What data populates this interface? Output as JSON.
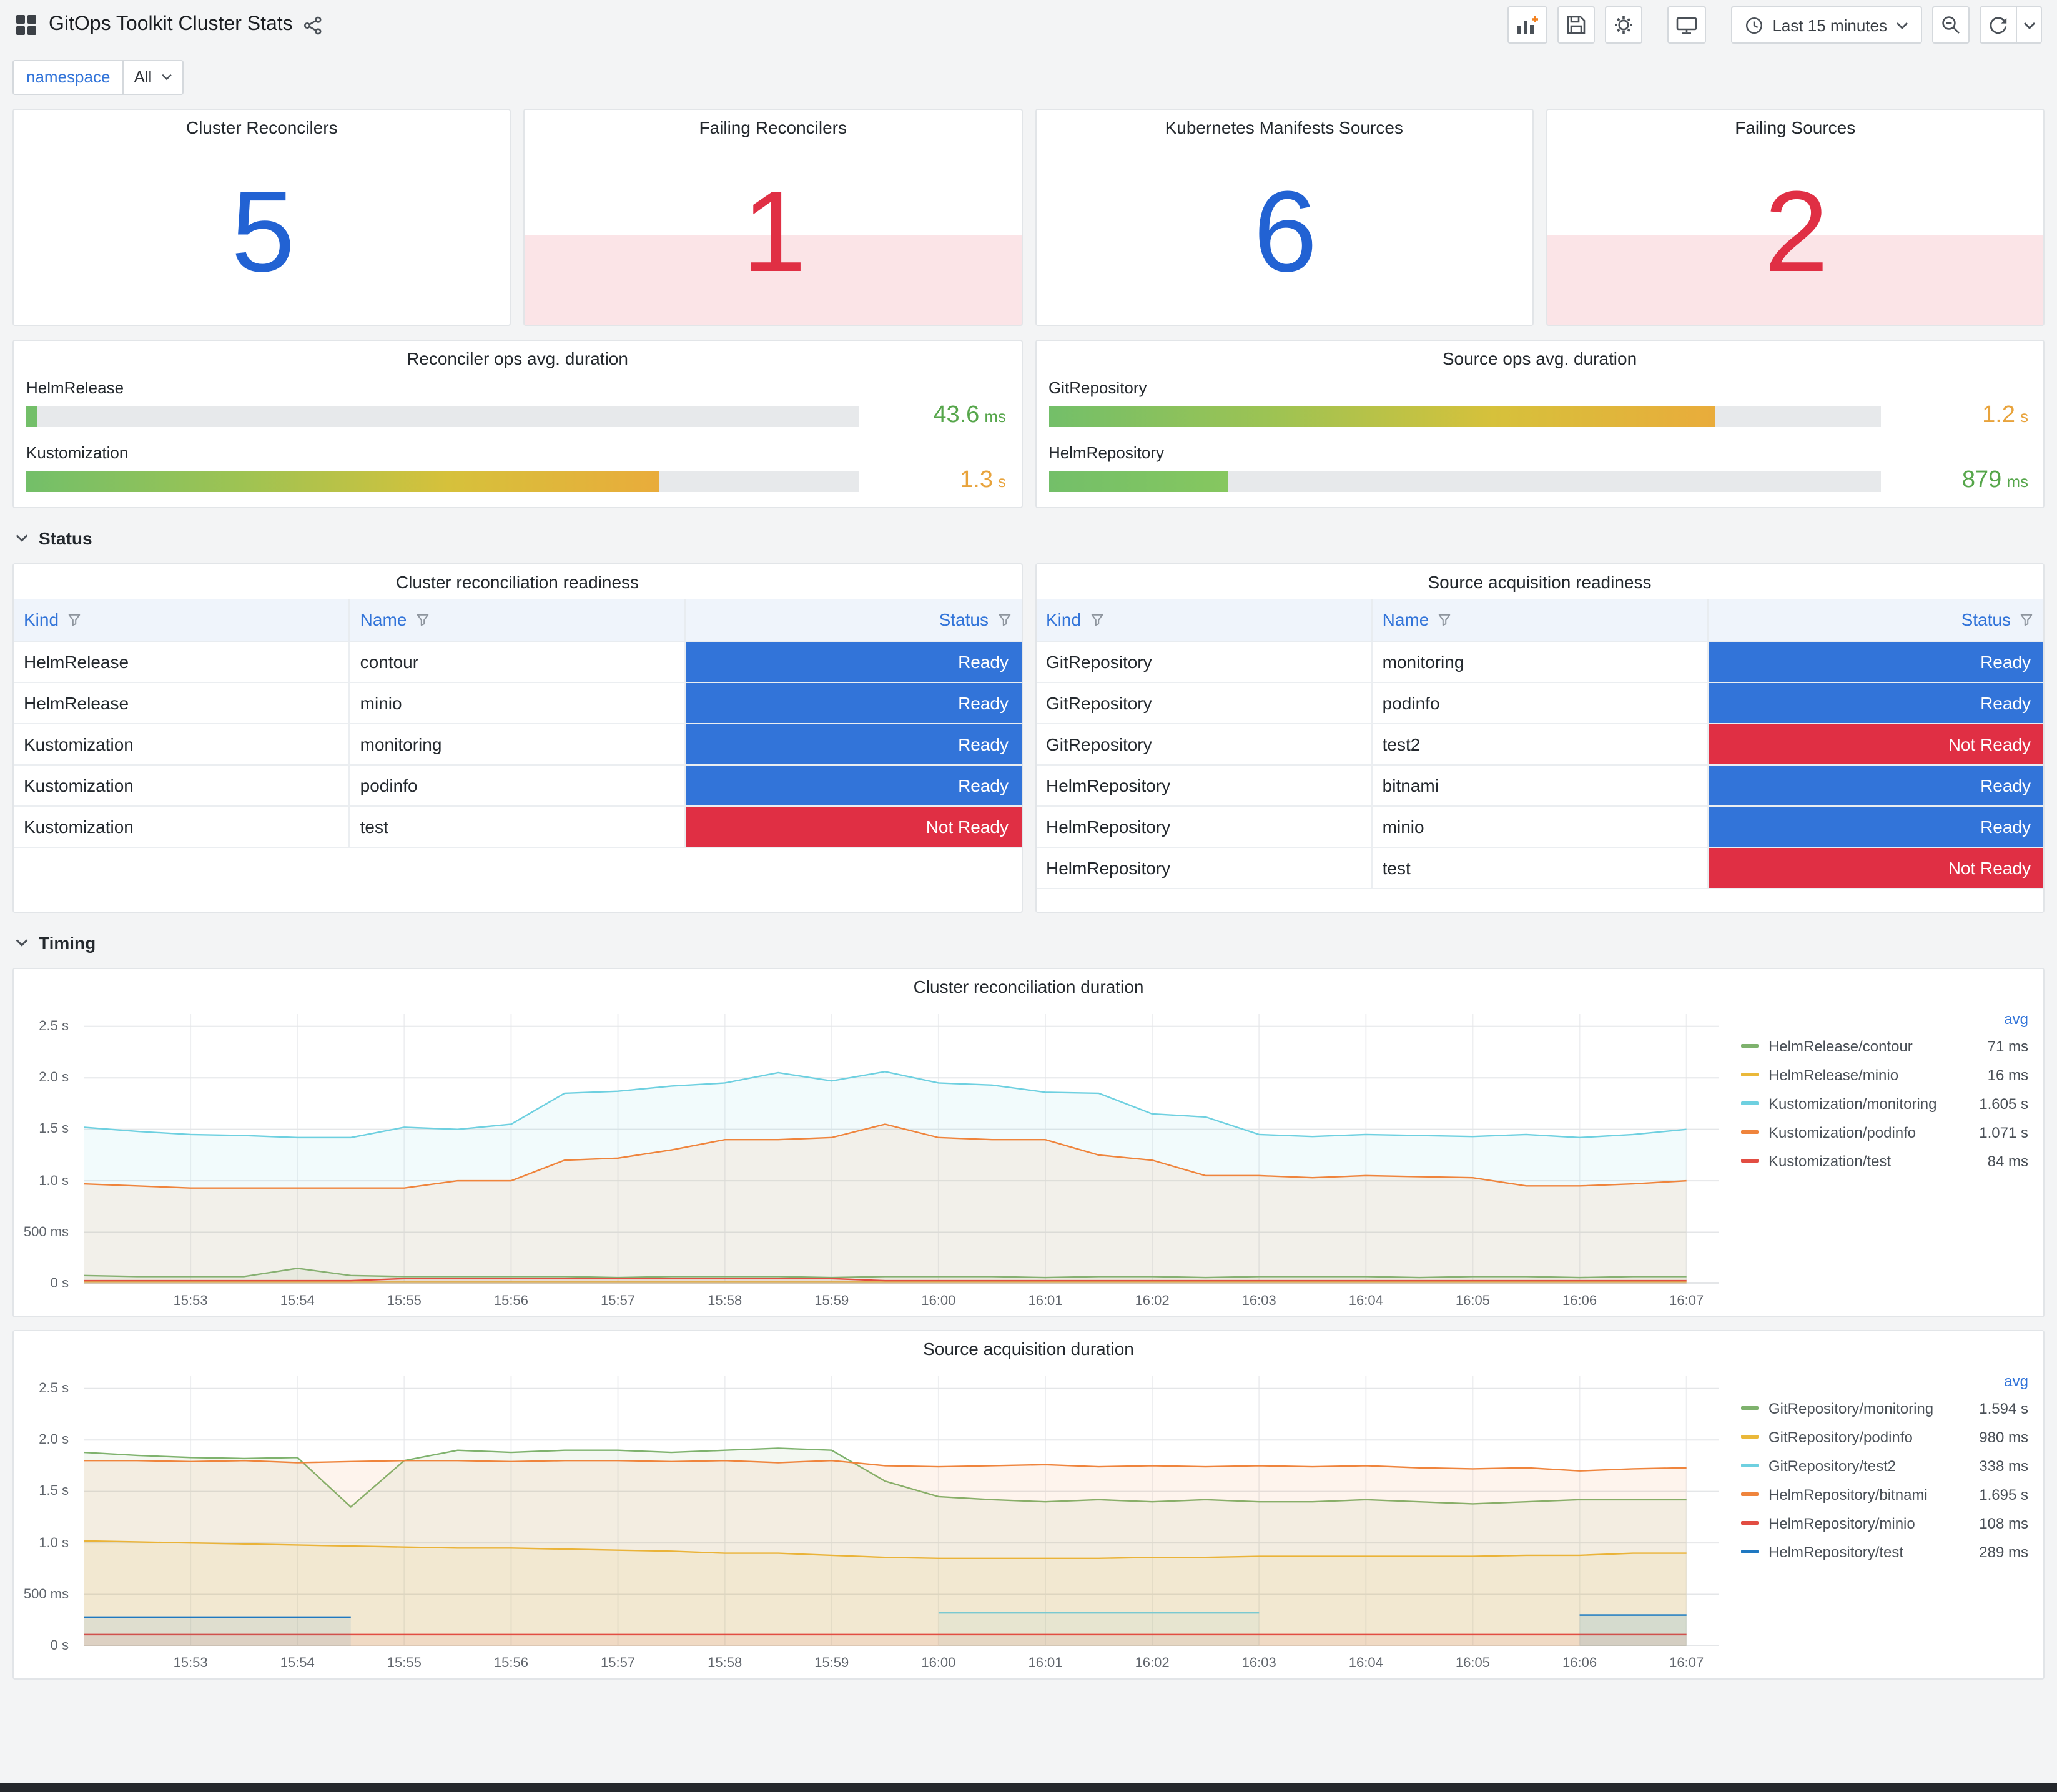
{
  "header": {
    "title": "GitOps Toolkit Cluster Stats"
  },
  "toolbar": {
    "time_range": "Last 15 minutes"
  },
  "variables": {
    "label": "namespace",
    "value": "All"
  },
  "sections": {
    "status": "Status",
    "timing": "Timing"
  },
  "colors": {
    "accent_blue": "#3274D9",
    "stat_blue": "#2262D3",
    "stat_red": "#E02F44",
    "ready_bg": "#3274D9",
    "not_ready_bg": "#E02F44",
    "value_green": "#56A64B",
    "value_orange": "#E8A33C"
  },
  "stats": [
    {
      "title": "Cluster Reconcilers",
      "value": "5",
      "state": "ok"
    },
    {
      "title": "Failing Reconcilers",
      "value": "1",
      "state": "failing"
    },
    {
      "title": "Kubernetes Manifests Sources",
      "value": "6",
      "state": "ok"
    },
    {
      "title": "Failing Sources",
      "value": "2",
      "state": "failing"
    }
  ],
  "gauges": [
    {
      "title": "Reconciler ops avg. duration",
      "rows": [
        {
          "label": "HelmRelease",
          "value": "43.6",
          "unit": "ms",
          "pct": 1.3,
          "value_color": "#56A64B",
          "bar_colors": [
            "#73BF69"
          ]
        },
        {
          "label": "Kustomization",
          "value": "1.3",
          "unit": "s",
          "pct": 76,
          "value_color": "#E8A33C",
          "bar_colors": [
            "#73BF69",
            "#9DC353",
            "#D6C13B",
            "#E9AC3B"
          ]
        }
      ]
    },
    {
      "title": "Source ops avg. duration",
      "rows": [
        {
          "label": "GitRepository",
          "value": "1.2",
          "unit": "s",
          "pct": 80,
          "value_color": "#E8A33C",
          "bar_colors": [
            "#73BF69",
            "#9DC353",
            "#D6C13B",
            "#E9AC3B"
          ]
        },
        {
          "label": "HelmRepository",
          "value": "879",
          "unit": "ms",
          "pct": 21.5,
          "value_color": "#56A64B",
          "bar_colors": [
            "#73BF69",
            "#86C75F"
          ]
        }
      ]
    }
  ],
  "tables": [
    {
      "title": "Cluster reconciliation readiness",
      "columns": [
        "Kind",
        "Name",
        "Status"
      ],
      "rows": [
        [
          "HelmRelease",
          "contour",
          "Ready"
        ],
        [
          "HelmRelease",
          "minio",
          "Ready"
        ],
        [
          "Kustomization",
          "monitoring",
          "Ready"
        ],
        [
          "Kustomization",
          "podinfo",
          "Ready"
        ],
        [
          "Kustomization",
          "test",
          "Not Ready"
        ]
      ]
    },
    {
      "title": "Source acquisition readiness",
      "columns": [
        "Kind",
        "Name",
        "Status"
      ],
      "rows": [
        [
          "GitRepository",
          "monitoring",
          "Ready"
        ],
        [
          "GitRepository",
          "podinfo",
          "Ready"
        ],
        [
          "GitRepository",
          "test2",
          "Not Ready"
        ],
        [
          "HelmRepository",
          "bitnami",
          "Ready"
        ],
        [
          "HelmRepository",
          "minio",
          "Ready"
        ],
        [
          "HelmRepository",
          "test",
          "Not Ready"
        ]
      ]
    }
  ],
  "chart_data": [
    {
      "type": "line",
      "title": "Cluster reconciliation duration",
      "legend_header": "avg",
      "legend_position": "right",
      "grid": true,
      "x_unit": "minutes after 15:52",
      "xlim": [
        0,
        15.3
      ],
      "ylim": [
        0,
        2.62
      ],
      "x": [
        0,
        0.5,
        1,
        1.5,
        2,
        2.5,
        3,
        3.5,
        4,
        4.5,
        5,
        5.5,
        6,
        6.5,
        7,
        7.5,
        8,
        8.5,
        9,
        9.5,
        10,
        10.5,
        11,
        11.5,
        12,
        12.5,
        13,
        13.5,
        14,
        14.5,
        15
      ],
      "x_ticks": [
        {
          "v": 1,
          "label": "15:53"
        },
        {
          "v": 2,
          "label": "15:54"
        },
        {
          "v": 3,
          "label": "15:55"
        },
        {
          "v": 4,
          "label": "15:56"
        },
        {
          "v": 5,
          "label": "15:57"
        },
        {
          "v": 6,
          "label": "15:58"
        },
        {
          "v": 7,
          "label": "15:59"
        },
        {
          "v": 8,
          "label": "16:00"
        },
        {
          "v": 9,
          "label": "16:01"
        },
        {
          "v": 10,
          "label": "16:02"
        },
        {
          "v": 11,
          "label": "16:03"
        },
        {
          "v": 12,
          "label": "16:04"
        },
        {
          "v": 13,
          "label": "16:05"
        },
        {
          "v": 14,
          "label": "16:06"
        },
        {
          "v": 15,
          "label": "16:07"
        }
      ],
      "y_ticks": [
        {
          "v": 0,
          "label": "0 s"
        },
        {
          "v": 0.5,
          "label": "500 ms"
        },
        {
          "v": 1,
          "label": "1.0 s"
        },
        {
          "v": 1.5,
          "label": "1.5 s"
        },
        {
          "v": 2,
          "label": "2.0 s"
        },
        {
          "v": 2.5,
          "label": "2.5 s"
        }
      ],
      "series": [
        {
          "name": "HelmRelease/contour",
          "color": "#7EB26D",
          "avg": "71 ms",
          "values": [
            0.08,
            0.07,
            0.07,
            0.07,
            0.15,
            0.08,
            0.07,
            0.07,
            0.07,
            0.07,
            0.06,
            0.07,
            0.07,
            0.07,
            0.06,
            0.07,
            0.07,
            0.07,
            0.06,
            0.07,
            0.07,
            0.06,
            0.07,
            0.07,
            0.07,
            0.06,
            0.07,
            0.07,
            0.06,
            0.07,
            0.07
          ]
        },
        {
          "name": "HelmRelease/minio",
          "color": "#EAB839",
          "avg": "16 ms",
          "values": [
            0.016,
            0.016,
            0.016,
            0.016,
            0.016,
            0.016,
            0.016,
            0.016,
            0.016,
            0.016,
            0.016,
            0.016,
            0.016,
            0.016,
            0.016,
            0.016,
            0.016,
            0.016,
            0.016,
            0.016,
            0.016,
            0.016,
            0.016,
            0.016,
            0.016,
            0.016,
            0.016,
            0.016,
            0.016,
            0.016,
            0.016
          ]
        },
        {
          "name": "Kustomization/monitoring",
          "color": "#6ED0E0",
          "avg": "1.605 s",
          "values": [
            1.52,
            1.48,
            1.45,
            1.44,
            1.42,
            1.42,
            1.52,
            1.5,
            1.55,
            1.85,
            1.87,
            1.92,
            1.95,
            2.05,
            1.97,
            2.06,
            1.95,
            1.93,
            1.86,
            1.85,
            1.65,
            1.62,
            1.45,
            1.43,
            1.45,
            1.44,
            1.43,
            1.45,
            1.42,
            1.45,
            1.5
          ]
        },
        {
          "name": "Kustomization/podinfo",
          "color": "#EF843C",
          "avg": "1.071 s",
          "values": [
            0.97,
            0.95,
            0.93,
            0.93,
            0.93,
            0.93,
            0.93,
            1.0,
            1.0,
            1.2,
            1.22,
            1.3,
            1.4,
            1.4,
            1.42,
            1.55,
            1.42,
            1.4,
            1.4,
            1.25,
            1.2,
            1.05,
            1.05,
            1.03,
            1.05,
            1.04,
            1.03,
            0.95,
            0.95,
            0.97,
            1.0
          ]
        },
        {
          "name": "Kustomization/test",
          "color": "#E24D42",
          "avg": "84 ms",
          "values": [
            0.03,
            0.03,
            0.03,
            0.03,
            0.03,
            0.03,
            0.05,
            0.05,
            0.05,
            0.05,
            0.05,
            0.05,
            0.05,
            0.05,
            0.05,
            0.03,
            0.03,
            0.03,
            0.03,
            0.03,
            0.03,
            0.03,
            0.03,
            0.03,
            0.03,
            0.03,
            0.03,
            0.03,
            0.03,
            0.03,
            0.03
          ]
        }
      ]
    },
    {
      "type": "line",
      "title": "Source acquisition duration",
      "legend_header": "avg",
      "legend_position": "right",
      "grid": true,
      "x_unit": "minutes after 15:52",
      "xlim": [
        0,
        15.3
      ],
      "ylim": [
        0,
        2.62
      ],
      "x": [
        0,
        0.5,
        1,
        1.5,
        2,
        2.5,
        3,
        3.5,
        4,
        4.5,
        5,
        5.5,
        6,
        6.5,
        7,
        7.5,
        8,
        8.5,
        9,
        9.5,
        10,
        10.5,
        11,
        11.5,
        12,
        12.5,
        13,
        13.5,
        14,
        14.5,
        15
      ],
      "x_ticks": [
        {
          "v": 1,
          "label": "15:53"
        },
        {
          "v": 2,
          "label": "15:54"
        },
        {
          "v": 3,
          "label": "15:55"
        },
        {
          "v": 4,
          "label": "15:56"
        },
        {
          "v": 5,
          "label": "15:57"
        },
        {
          "v": 6,
          "label": "15:58"
        },
        {
          "v": 7,
          "label": "15:59"
        },
        {
          "v": 8,
          "label": "16:00"
        },
        {
          "v": 9,
          "label": "16:01"
        },
        {
          "v": 10,
          "label": "16:02"
        },
        {
          "v": 11,
          "label": "16:03"
        },
        {
          "v": 12,
          "label": "16:04"
        },
        {
          "v": 13,
          "label": "16:05"
        },
        {
          "v": 14,
          "label": "16:06"
        },
        {
          "v": 15,
          "label": "16:07"
        }
      ],
      "y_ticks": [
        {
          "v": 0,
          "label": "0 s"
        },
        {
          "v": 0.5,
          "label": "500 ms"
        },
        {
          "v": 1,
          "label": "1.0 s"
        },
        {
          "v": 1.5,
          "label": "1.5 s"
        },
        {
          "v": 2,
          "label": "2.0 s"
        },
        {
          "v": 2.5,
          "label": "2.5 s"
        }
      ],
      "series": [
        {
          "name": "GitRepository/monitoring",
          "color": "#7EB26D",
          "avg": "1.594 s",
          "values": [
            1.88,
            1.85,
            1.83,
            1.82,
            1.83,
            1.35,
            1.8,
            1.9,
            1.88,
            1.9,
            1.9,
            1.88,
            1.9,
            1.92,
            1.9,
            1.6,
            1.45,
            1.42,
            1.4,
            1.42,
            1.4,
            1.42,
            1.4,
            1.4,
            1.42,
            1.4,
            1.38,
            1.4,
            1.42,
            1.42,
            1.42
          ]
        },
        {
          "name": "GitRepository/podinfo",
          "color": "#EAB839",
          "avg": "980 ms",
          "values": [
            1.02,
            1.01,
            1.0,
            0.99,
            0.98,
            0.97,
            0.96,
            0.95,
            0.95,
            0.94,
            0.93,
            0.92,
            0.9,
            0.9,
            0.88,
            0.86,
            0.85,
            0.85,
            0.85,
            0.85,
            0.86,
            0.86,
            0.87,
            0.87,
            0.87,
            0.87,
            0.87,
            0.88,
            0.88,
            0.9,
            0.9
          ]
        },
        {
          "name": "GitRepository/test2",
          "color": "#6ED0E0",
          "avg": "338 ms",
          "values": [
            null,
            null,
            null,
            null,
            null,
            null,
            null,
            null,
            null,
            null,
            null,
            null,
            null,
            null,
            null,
            null,
            0.32,
            0.32,
            0.32,
            0.32,
            0.32,
            0.32,
            0.32,
            null,
            null,
            null,
            null,
            null,
            0.3,
            0.3,
            0.3
          ]
        },
        {
          "name": "HelmRepository/bitnami",
          "color": "#EF843C",
          "avg": "1.695 s",
          "values": [
            1.8,
            1.8,
            1.79,
            1.8,
            1.78,
            1.79,
            1.8,
            1.8,
            1.79,
            1.8,
            1.8,
            1.79,
            1.8,
            1.78,
            1.8,
            1.75,
            1.74,
            1.75,
            1.76,
            1.74,
            1.75,
            1.74,
            1.75,
            1.74,
            1.75,
            1.73,
            1.72,
            1.73,
            1.7,
            1.72,
            1.73
          ]
        },
        {
          "name": "HelmRepository/minio",
          "color": "#E24D42",
          "avg": "108 ms",
          "values": [
            0.11,
            0.11,
            0.11,
            0.11,
            0.11,
            0.11,
            0.11,
            0.11,
            0.11,
            0.11,
            0.11,
            0.11,
            0.11,
            0.11,
            0.11,
            0.11,
            0.11,
            0.11,
            0.11,
            0.11,
            0.11,
            0.11,
            0.11,
            0.11,
            0.11,
            0.11,
            0.11,
            0.11,
            0.11,
            0.11,
            0.11
          ]
        },
        {
          "name": "HelmRepository/test",
          "color": "#1F78C1",
          "avg": "289 ms",
          "values": [
            0.28,
            0.28,
            0.28,
            0.28,
            0.28,
            0.28,
            null,
            null,
            null,
            null,
            null,
            null,
            null,
            null,
            null,
            null,
            null,
            null,
            null,
            null,
            null,
            null,
            null,
            null,
            null,
            null,
            null,
            null,
            0.3,
            0.3,
            0.3
          ]
        }
      ]
    }
  ]
}
